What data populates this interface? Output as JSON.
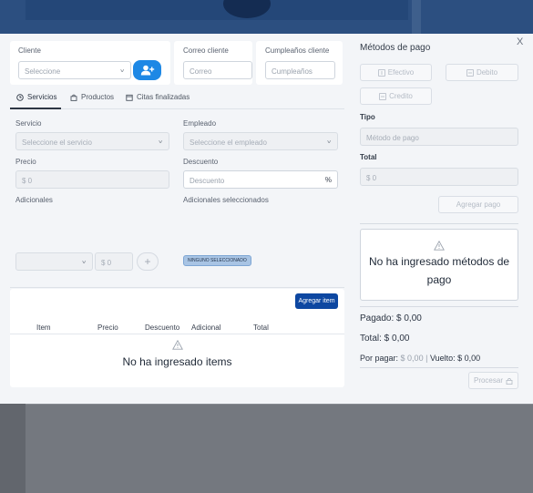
{
  "client": {
    "label": "Cliente",
    "select_value": "Seleccione",
    "email_label": "Correo cliente",
    "email_placeholder": "Correo",
    "birthday_label": "Cumpleaños cliente",
    "birthday_placeholder": "Cumpleaños"
  },
  "tabs": [
    {
      "label": "Servicios",
      "icon": "clock-icon",
      "active": true
    },
    {
      "label": "Productos",
      "icon": "bag-icon",
      "active": false
    },
    {
      "label": "Citas finalizadas",
      "icon": "calendar-icon",
      "active": false
    }
  ],
  "form": {
    "service_label": "Servicio",
    "service_placeholder": "Seleccione el servicio",
    "employee_label": "Empleado",
    "employee_placeholder": "Seleccione el empleado",
    "price_label": "Precio",
    "price_value": "$ 0",
    "discount_label": "Descuento",
    "discount_placeholder": "Descuento",
    "discount_suffix": "%",
    "additionals_label": "Adicionales",
    "additional_value": "$ 0",
    "additional_add": "+",
    "selected_additionals_label": "Adicionales seleccionados",
    "selected_badge": "NINGUNO SELECCIONADO"
  },
  "items": {
    "add_button": "Agregar item",
    "columns": [
      "Item",
      "Precio",
      "Descuento",
      "Adicional",
      "Total"
    ],
    "empty_message": "No ha ingresado items"
  },
  "payment": {
    "title": "Métodos de pago",
    "close": "X",
    "methods": [
      "Efectivo",
      "Debito",
      "Credito"
    ],
    "type_label": "Tipo",
    "type_placeholder": "Método de pago",
    "total_label": "Total",
    "total_value": "$ 0",
    "add_payment": "Agregar pago",
    "empty_message": "No ha ingresado métodos de pago",
    "paid": "Pagado: $ 0,00",
    "total": "Total: $ 0,00",
    "to_pay_label": "Por pagar:",
    "to_pay_value": "$ 0,00",
    "change_sep": "|",
    "change_label": "Vuelto: $ 0,00",
    "process_button": "Procesar"
  },
  "colors": {
    "primary": "#1e88e5",
    "primary_dark": "#0d47a1",
    "badge_bg": "#a8c4e4",
    "modal_bg": "#f3f5f8"
  }
}
